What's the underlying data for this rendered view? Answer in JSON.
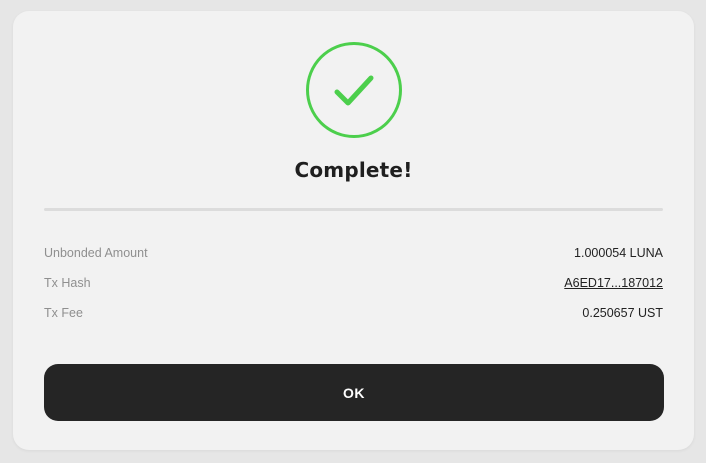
{
  "dialog": {
    "title": "Complete!",
    "status_icon": "check-circle-icon",
    "colors": {
      "success": "#4ccf4c",
      "button_bg": "#252525",
      "label": "#8f8f8f",
      "value": "#222222"
    }
  },
  "details": [
    {
      "label": "Unbonded Amount",
      "value": "1.000054 LUNA"
    },
    {
      "label": "Tx Hash",
      "value": "A6ED17...187012"
    },
    {
      "label": "Tx Fee",
      "value": "0.250657 UST"
    }
  ],
  "ok_button": {
    "label": "OK"
  }
}
